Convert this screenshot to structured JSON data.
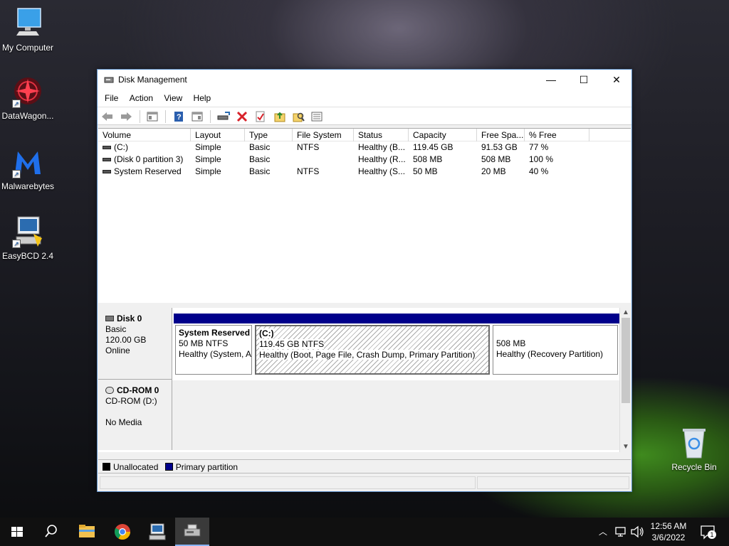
{
  "desktop": {
    "icons": [
      {
        "label": "My Computer",
        "icon": "monitor-icon"
      },
      {
        "label": "DataWagon...",
        "icon": "datawagon-icon"
      },
      {
        "label": "Malwarebytes",
        "icon": "malwarebytes-icon"
      },
      {
        "label": "EasyBCD 2.4",
        "icon": "easybcd-icon"
      },
      {
        "label": "Recycle Bin",
        "icon": "recycle-bin-icon"
      }
    ]
  },
  "window": {
    "title": "Disk Management",
    "menu": [
      "File",
      "Action",
      "View",
      "Help"
    ],
    "controls": {
      "minimize": "—",
      "maximize": "☐",
      "close": "✕"
    }
  },
  "volume_list": {
    "columns": [
      "Volume",
      "Layout",
      "Type",
      "File System",
      "Status",
      "Capacity",
      "Free Spa...",
      "% Free"
    ],
    "rows": [
      {
        "volume": "(C:)",
        "layout": "Simple",
        "type": "Basic",
        "fs": "NTFS",
        "status": "Healthy (B...",
        "capacity": "119.45 GB",
        "free": "91.53 GB",
        "pct": "77 %"
      },
      {
        "volume": "(Disk 0 partition 3)",
        "layout": "Simple",
        "type": "Basic",
        "fs": "",
        "status": "Healthy (R...",
        "capacity": "508 MB",
        "free": "508 MB",
        "pct": "100 %"
      },
      {
        "volume": "System Reserved",
        "layout": "Simple",
        "type": "Basic",
        "fs": "NTFS",
        "status": "Healthy (S...",
        "capacity": "50 MB",
        "free": "20 MB",
        "pct": "40 %"
      }
    ]
  },
  "disks": [
    {
      "name": "Disk 0",
      "kind": "Basic",
      "size": "120.00 GB",
      "state": "Online",
      "partitions": [
        {
          "title": "System Reserved",
          "line2": "50 MB NTFS",
          "line3": "Healthy (System, A"
        },
        {
          "title": "(C:)",
          "line2": "119.45 GB NTFS",
          "line3": "Healthy (Boot, Page File, Crash Dump, Primary Partition)"
        },
        {
          "title": "",
          "line2": "508 MB",
          "line3": "Healthy (Recovery Partition)"
        }
      ]
    },
    {
      "name": "CD-ROM 0",
      "drive": "CD-ROM (D:)",
      "media": "No Media"
    }
  ],
  "legend": {
    "unallocated": "Unallocated",
    "primary": "Primary partition",
    "unallocated_color": "#000000",
    "primary_color": "#00008b"
  },
  "taskbar": {
    "time": "12:56 AM",
    "date": "3/6/2022",
    "notifications": "1",
    "items": [
      "start-icon",
      "search-icon",
      "file-explorer-icon",
      "chrome-icon",
      "network-computer-icon",
      "disk-management-icon"
    ]
  }
}
